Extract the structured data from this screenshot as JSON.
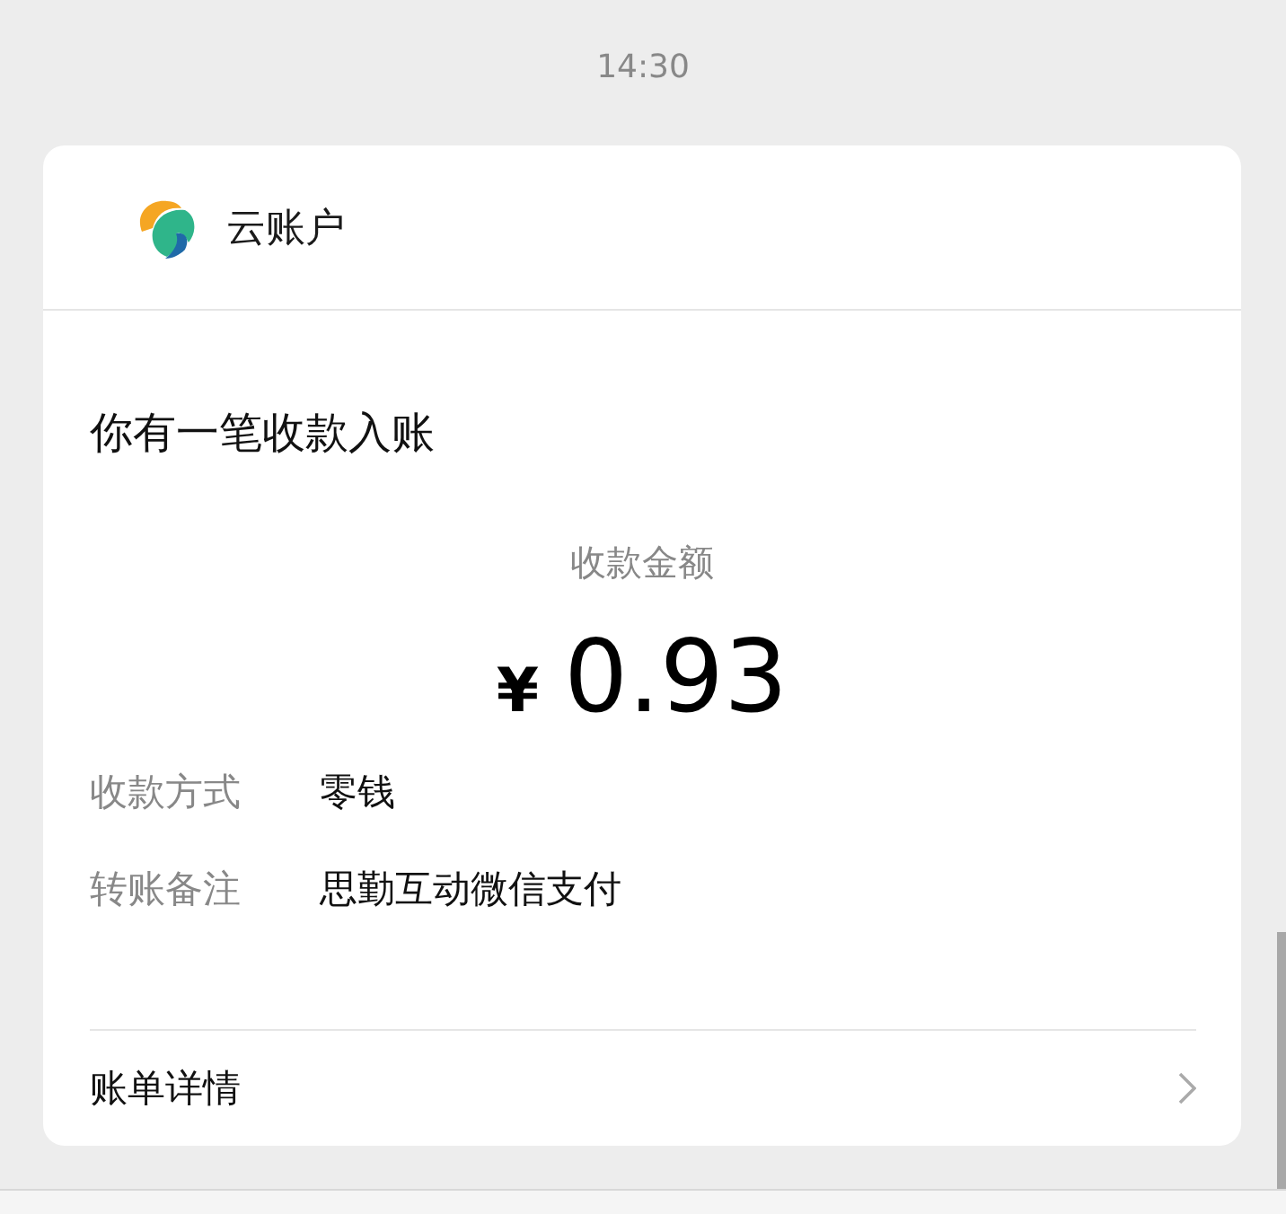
{
  "time": "14:30",
  "card": {
    "account_name": "云账户",
    "title": "你有一笔收款入账",
    "amount_label": "收款金额",
    "currency": "¥",
    "amount": "0.93",
    "details": [
      {
        "label": "收款方式",
        "value": "零钱"
      },
      {
        "label": "转账备注",
        "value": "思勤互动微信支付"
      }
    ],
    "footer_link": "账单详情"
  }
}
